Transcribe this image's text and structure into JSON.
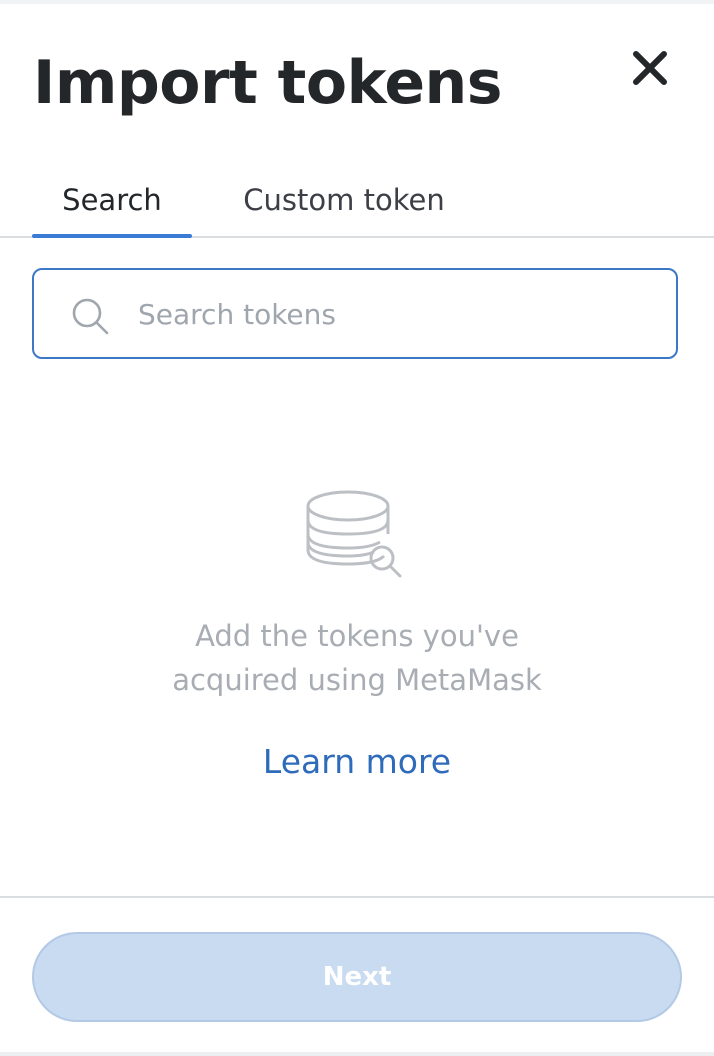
{
  "modal": {
    "title": "Import tokens",
    "close_icon": "close-icon"
  },
  "tabs": [
    {
      "label": "Search",
      "active": true
    },
    {
      "label": "Custom token",
      "active": false
    }
  ],
  "search": {
    "icon": "search-icon",
    "placeholder": "Search tokens",
    "value": ""
  },
  "empty_state": {
    "icon": "coin-stack-search-icon",
    "line1": "Add the tokens you've",
    "line2": "acquired using MetaMask",
    "link_label": "Learn more"
  },
  "footer": {
    "next_label": "Next",
    "next_disabled": true
  },
  "colors": {
    "accent": "#3a7bd5",
    "link": "#2f6bbb",
    "title": "#24272a",
    "muted_text": "#a8adb3",
    "disabled_button": "#c9dbf1"
  }
}
